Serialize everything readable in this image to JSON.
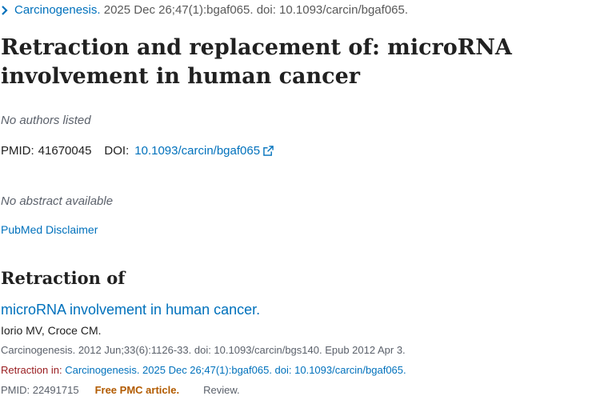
{
  "header": {
    "journal_name": "Carcinogenesis.",
    "citation": " 2025 Dec 26;47(1):bgaf065. doi: 10.1093/carcin/bgaf065."
  },
  "article": {
    "title": "Retraction and replacement of: microRNA involvement in human cancer",
    "authors": "No authors listed",
    "pmid_label": "PMID:",
    "pmid": "41670045",
    "doi_label": "DOI:",
    "doi": "10.1093/carcin/bgaf065",
    "abstract": "No abstract available",
    "disclaimer": "PubMed Disclaimer"
  },
  "retraction_of": {
    "heading": "Retraction of",
    "item": {
      "title": "microRNA involvement in human cancer.",
      "authors": "Iorio MV, Croce CM.",
      "journal": "Carcinogenesis. 2012 Jun;33(6):1126-33. doi: 10.1093/carcin/bgs140. Epub 2012 Apr 3.",
      "retraction_label": "Retraction in:",
      "retraction_link": "Carcinogenesis. 2025 Dec 26;47(1):bgaf065. doi: 10.1093/carcin/bgaf065.",
      "pmid": "PMID: 22491715",
      "free_pmc": "Free PMC article.",
      "type": "Review."
    }
  },
  "colors": {
    "link": "#0071bc",
    "retraction": "#981b1e",
    "free_pmc": "#b25b00"
  },
  "icons": [
    "chevron-right-icon",
    "external-link-icon"
  ]
}
